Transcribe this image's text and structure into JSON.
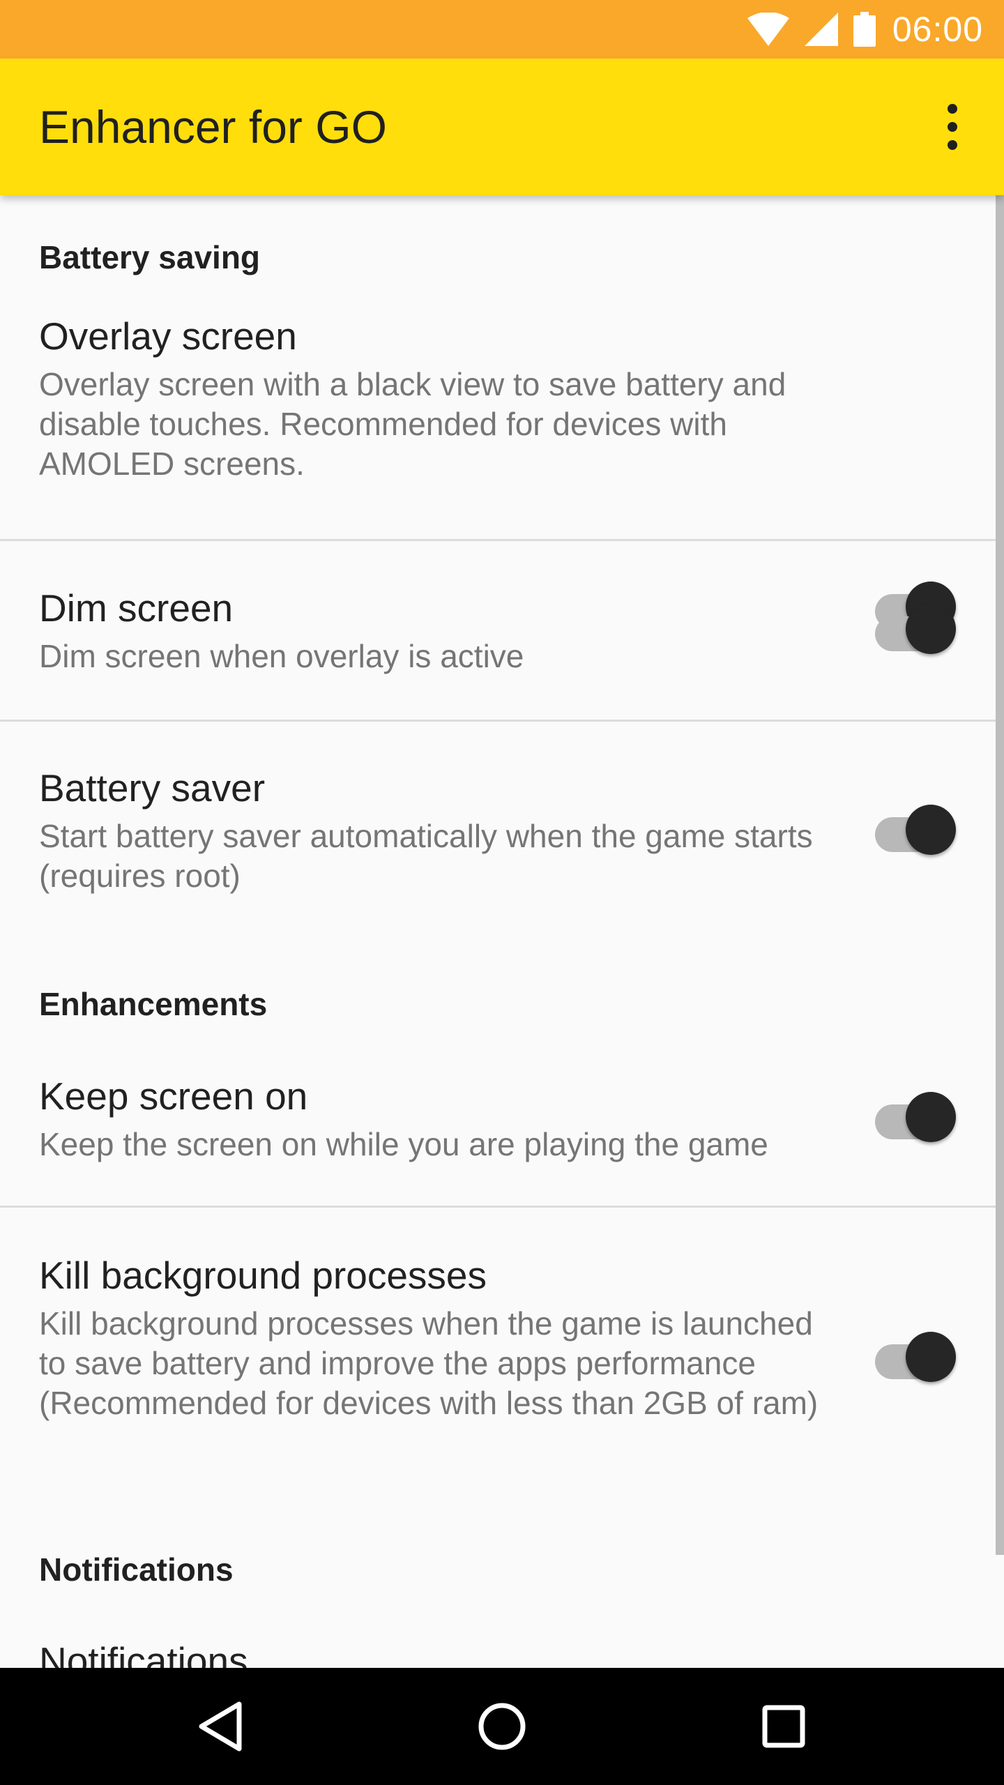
{
  "status_bar": {
    "time": "06:00",
    "icons": [
      "wifi-icon",
      "cell-signal-icon",
      "battery-icon"
    ]
  },
  "app_bar": {
    "title": "Enhancer for GO",
    "menu_icon": "more-vert-icon"
  },
  "sections": {
    "battery_saving": {
      "header": "Battery saving",
      "items": [
        {
          "title": "Overlay screen",
          "summary": "Overlay screen with a black view to save battery and disable touches. Recommended for devices with AMOLED screens.",
          "enabled": true
        },
        {
          "title": "Dim screen",
          "summary": "Dim screen when overlay is active",
          "enabled": true
        },
        {
          "title": "Battery saver",
          "summary": "Start battery saver automatically when the game starts (requires root)",
          "enabled": true
        }
      ]
    },
    "enhancements": {
      "header": "Enhancements",
      "items": [
        {
          "title": "Keep screen on",
          "summary": "Keep the screen on while you are playing the game",
          "enabled": true
        },
        {
          "title": "Kill background processes",
          "summary": "Kill background processes when the game is launched to save battery and improve the apps performance (Recommended for devices with less than 2GB of ram)",
          "enabled": true
        }
      ]
    },
    "notifications": {
      "header": "Notifications",
      "items": [
        {
          "title": "Notifications"
        }
      ]
    }
  },
  "nav_bar": {
    "icons": [
      "back-icon",
      "home-icon",
      "recents-icon"
    ]
  },
  "colors": {
    "status_bar": "#f9a82a",
    "app_bar": "#ffde0b",
    "background": "#fafafa",
    "switch_thumb": "#262626",
    "switch_track": "#b8b8b8"
  }
}
